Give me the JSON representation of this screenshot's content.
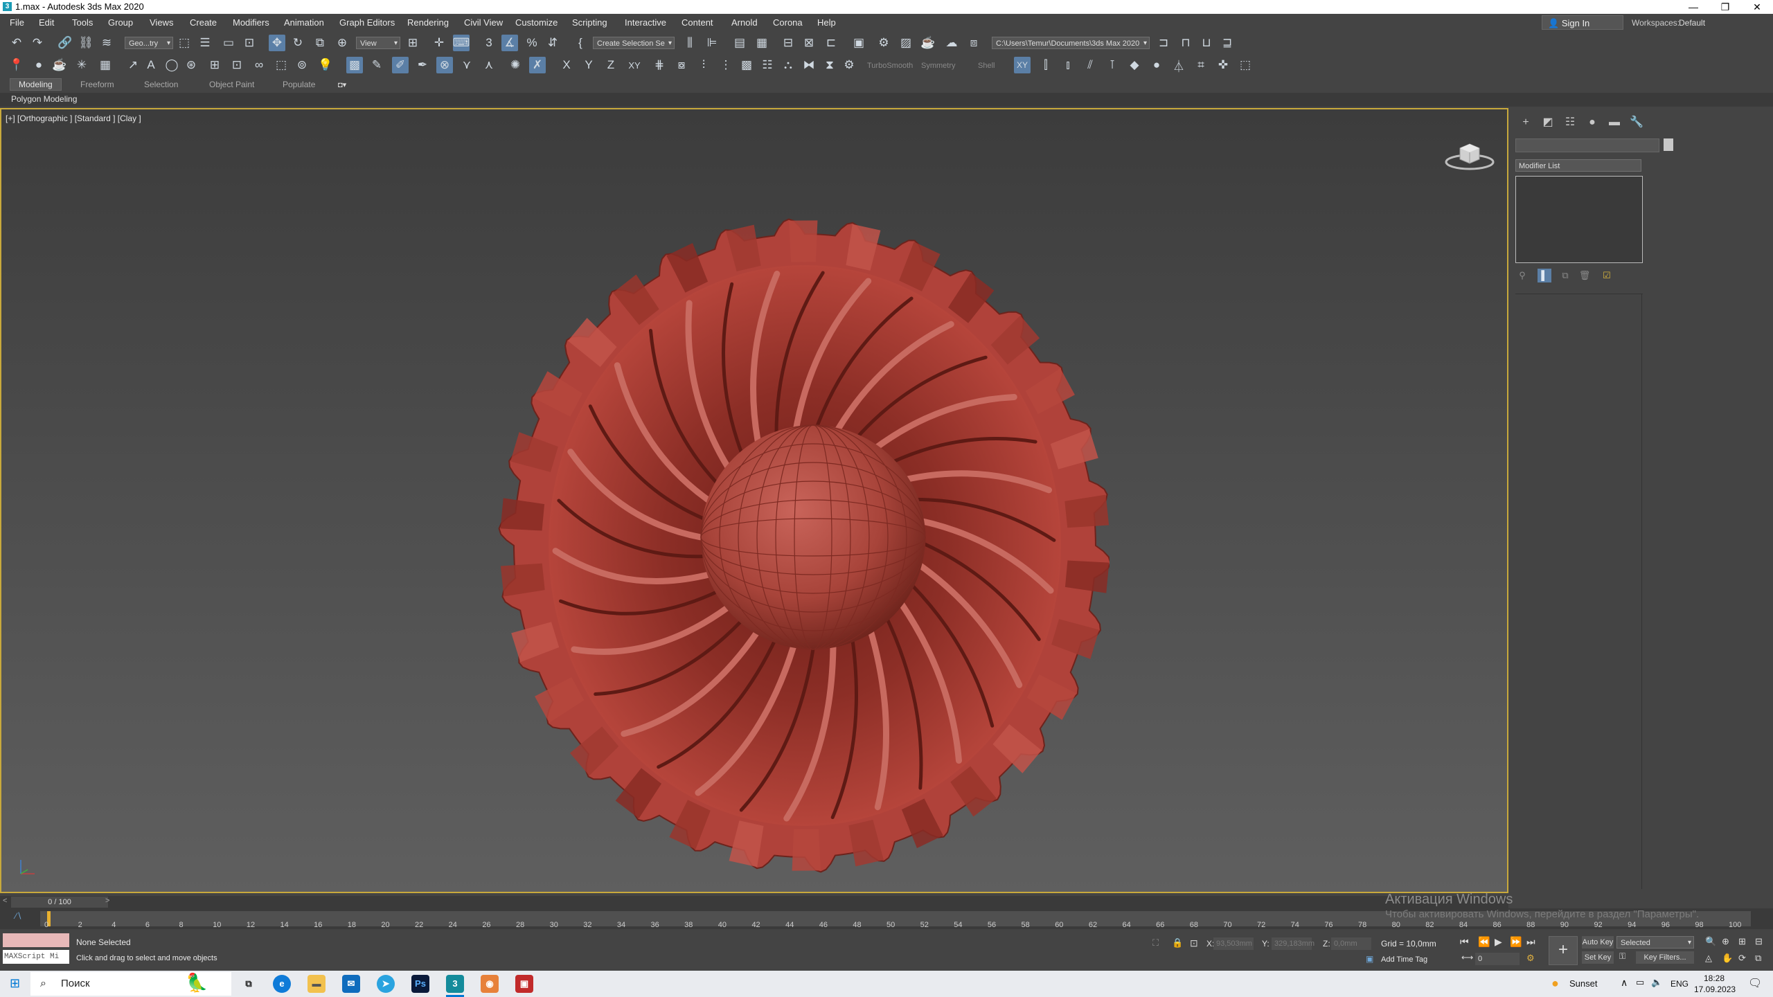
{
  "window": {
    "title": "1.max - Autodesk 3ds Max 2020",
    "app_icon": "3",
    "minimize": "—",
    "maximize": "❐",
    "close": "✕"
  },
  "menu": {
    "items": [
      "File",
      "Edit",
      "Tools",
      "Group",
      "Views",
      "Create",
      "Modifiers",
      "Animation",
      "Graph Editors",
      "Rendering",
      "Civil View",
      "Customize",
      "Scripting",
      "Interactive",
      "Content",
      "Arnold",
      "Corona",
      "Help"
    ],
    "sign_in": "Sign In",
    "workspaces_label": "Workspaces:",
    "workspaces_value": "Default"
  },
  "toolbar": {
    "selection_filter": "Geo...try",
    "ref_coord": "View",
    "named_selection": "Create Selection Se",
    "project_path": "C:\\Users\\Temur\\Documents\\3ds Max 2020",
    "axis_x": "X",
    "axis_y": "Y",
    "axis_z": "Z",
    "axis_xy": "XY",
    "axis_xy_btn": "XY",
    "turbosmooth": "TurboSmooth",
    "symmetry": "Symmetry",
    "shell": "Shell"
  },
  "ribbon": {
    "tabs": [
      "Modeling",
      "Freeform",
      "Selection",
      "Object Paint",
      "Populate"
    ],
    "active_tab": "Modeling",
    "sub_label": "Polygon Modeling"
  },
  "viewport": {
    "label": "[+] [Orthographic ] [Standard ] [Clay ]",
    "object_color": "#b0423a"
  },
  "command_panel": {
    "modifier_list": "Modifier List"
  },
  "timeline": {
    "frame_display": "0 / 100",
    "ticks": [
      "0",
      "2",
      "4",
      "6",
      "8",
      "10",
      "12",
      "14",
      "16",
      "18",
      "20",
      "22",
      "24",
      "26",
      "28",
      "30",
      "32",
      "34",
      "36",
      "38",
      "40",
      "42",
      "44",
      "46",
      "48",
      "50",
      "52",
      "54",
      "56",
      "58",
      "60",
      "62",
      "64",
      "66",
      "68",
      "70",
      "72",
      "74",
      "76",
      "78",
      "80",
      "82",
      "84",
      "86",
      "88",
      "90",
      "92",
      "94",
      "96",
      "98",
      "100"
    ]
  },
  "status": {
    "maxscript": "MAXScript Mi",
    "selection_info": "None Selected",
    "prompt": "Click and drag to select and move objects",
    "x_label": "X:",
    "x_value": "93,503mm",
    "y_label": "Y:",
    "y_value": "329,183mm",
    "z_label": "Z:",
    "z_value": "0,0mm",
    "grid": "Grid = 10,0mm",
    "add_time_tag": "Add Time Tag",
    "auto_key": "Auto Key",
    "set_key": "Set Key",
    "key_mode": "Selected",
    "key_filters": "Key Filters...",
    "frame_input": "0"
  },
  "watermark": {
    "line1": "Активация Windows",
    "line2": "Чтобы активировать Windows, перейдите в раздел \"Параметры\"."
  },
  "taskbar": {
    "search_placeholder": "Поиск",
    "weather": "Sunset",
    "language": "ENG",
    "time": "18:28",
    "date": "17.09.2023"
  }
}
